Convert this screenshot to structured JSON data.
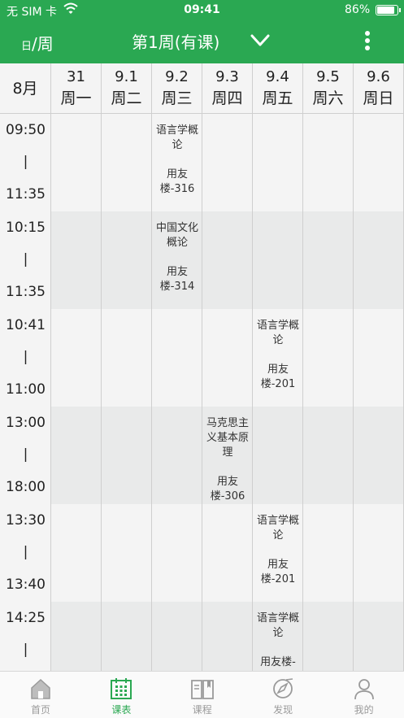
{
  "status_bar": {
    "carrier": "无 SIM 卡",
    "time": "09:41",
    "battery": "86%",
    "battery_level": 0.86
  },
  "nav": {
    "view_toggle_small": "日",
    "view_toggle_slash": "/",
    "view_toggle_large": "周",
    "week_title": "第1周(有课)",
    "dropdown_icon": "chevron-down-icon",
    "more_icon": "more-vertical-icon"
  },
  "schedule": {
    "month": "8月",
    "days": [
      {
        "date": "31",
        "weekday": "周一"
      },
      {
        "date": "9.1",
        "weekday": "周二"
      },
      {
        "date": "9.2",
        "weekday": "周三"
      },
      {
        "date": "9.3",
        "weekday": "周四"
      },
      {
        "date": "9.4",
        "weekday": "周五"
      },
      {
        "date": "9.5",
        "weekday": "周六"
      },
      {
        "date": "9.6",
        "weekday": "周日"
      }
    ],
    "slots": [
      {
        "start": "09:50",
        "sep": "|",
        "end": "11:35"
      },
      {
        "start": "10:15",
        "sep": "|",
        "end": "11:35"
      },
      {
        "start": "10:41",
        "sep": "|",
        "end": "11:00"
      },
      {
        "start": "13:00",
        "sep": "|",
        "end": "18:00"
      },
      {
        "start": "13:30",
        "sep": "|",
        "end": "13:40"
      },
      {
        "start": "14:25",
        "sep": "|",
        "end": ""
      }
    ],
    "courses": [
      {
        "slot": 0,
        "day": 2,
        "name": "语言学概论",
        "room": "用友楼-316"
      },
      {
        "slot": 1,
        "day": 2,
        "name": "中国文化概论",
        "room": "用友楼-314"
      },
      {
        "slot": 2,
        "day": 4,
        "name": "语言学概论",
        "room": "用友楼-201"
      },
      {
        "slot": 3,
        "day": 3,
        "name": "马克思主义基本原理",
        "room": "用友楼-306"
      },
      {
        "slot": 4,
        "day": 4,
        "name": "语言学概论",
        "room": "用友楼-201"
      },
      {
        "slot": 5,
        "day": 4,
        "name": "语言学概论",
        "room": "用友楼-"
      }
    ]
  },
  "tabs": [
    {
      "label": "首页",
      "icon": "home-icon",
      "active": false
    },
    {
      "label": "课表",
      "icon": "calendar-icon",
      "active": true
    },
    {
      "label": "课程",
      "icon": "book-icon",
      "active": false
    },
    {
      "label": "发现",
      "icon": "compass-icon",
      "active": false
    },
    {
      "label": "我的",
      "icon": "user-icon",
      "active": false
    }
  ],
  "colors": {
    "brand_green": "#2aa852",
    "tab_inactive": "#9a9a9a"
  }
}
